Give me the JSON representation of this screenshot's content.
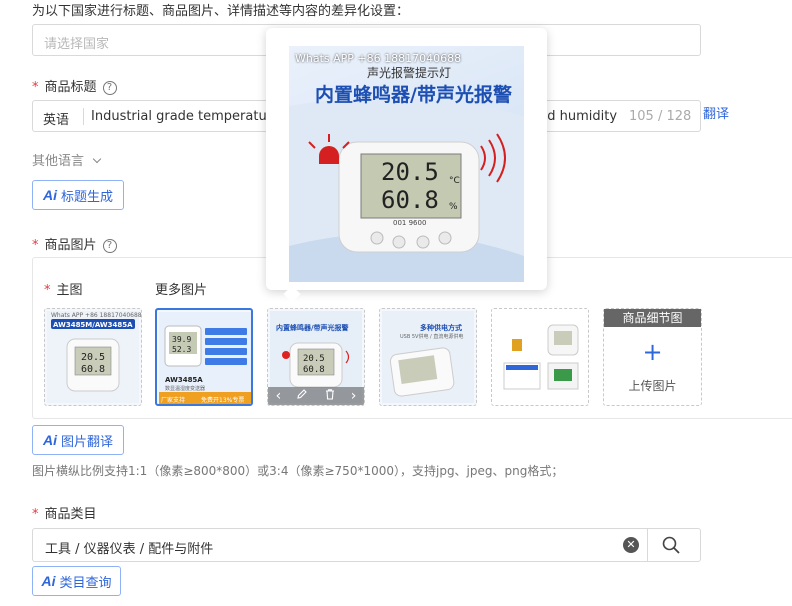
{
  "top_instruction": "为以下国家进行标题、商品图片、详情描述等内容的差异化设置：",
  "country_select": {
    "placeholder": "请选择国家"
  },
  "title_section": {
    "label": "商品标题",
    "help": "?",
    "lang": "英语",
    "value_left": "Industrial grade temperature",
    "value_right": "nd humidity",
    "counter": "105 / 128",
    "translate": "翻译"
  },
  "other_lang": {
    "label": "其他语言"
  },
  "ai_title_button": {
    "ai": "Ai",
    "label": "标题生成"
  },
  "images_section": {
    "label": "商品图片",
    "help": "?",
    "main_label": "主图",
    "more_label": "更多图片",
    "thumbs": [
      {
        "name": "main",
        "banner": "AW3485M/AW3485A",
        "sub": "Whats APP +86 18817040688"
      },
      {
        "name": "more-1",
        "caption": "AW3485A",
        "sub2": "数显温湿度变送器",
        "badge1": "厂家支持",
        "badge2": "免费开13%专票"
      },
      {
        "name": "more-2",
        "banner": "内置蜂鸣器/带声光报警"
      },
      {
        "name": "more-3",
        "banner": "多种供电方式",
        "sub": "USB 5V供电 / 直流电源供电"
      },
      {
        "name": "more-4"
      }
    ],
    "detail_header": "商品细节图",
    "upload_label": "上传图片",
    "upload_plus": "+",
    "tools": {
      "prev": "‹",
      "next": "›"
    }
  },
  "preview_popup": {
    "watermark": "Whats APP +86 18817040688",
    "subtitle": "声光报警提示灯",
    "headline": "内置蜂鸣器/带声光报警",
    "reading_temp": "20.5",
    "unit_temp": "°C",
    "reading_hum": "60.8",
    "unit_hum": "%",
    "small_line": "001 9600"
  },
  "ai_image_translate": {
    "ai": "Ai",
    "label": "图片翻译"
  },
  "image_hint": "图片横纵比例支持1:1（像素≥800*800）或3:4（像素≥750*1000），支持jpg、jpeg、png格式；",
  "category_section": {
    "label": "商品类目",
    "value": "工具 / 仪器仪表 / 配件与附件"
  },
  "ai_category_button": {
    "ai": "Ai",
    "label": "类目查询"
  },
  "colors": {
    "accent": "#2f66d9",
    "required": "#e4393c",
    "border": "#d9d9d9"
  }
}
